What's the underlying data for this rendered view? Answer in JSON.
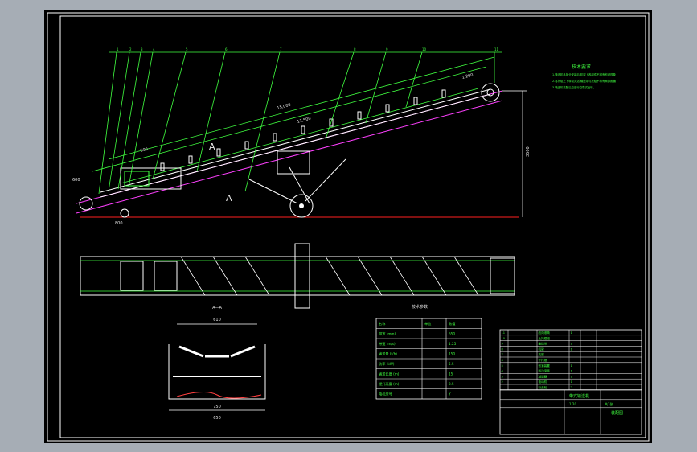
{
  "drawing": {
    "title": "",
    "section_label": "A—A",
    "view_label": "A",
    "dims": {
      "length": "15,000",
      "length_inner": "11,500",
      "height": "3500",
      "top": "1,200",
      "left_small": "600",
      "base": "800",
      "upper_left": "500",
      "sec_top": "610",
      "sec_mid": "750",
      "sec_bottom": "650"
    },
    "callouts": [
      "1",
      "2",
      "3",
      "4",
      "5",
      "6",
      "7",
      "8",
      "9",
      "10",
      "11"
    ],
    "tech_req": {
      "title": "技术要求",
      "lines": [
        "1.输送机各部分安装后,机架上各部件不得有松动现象",
        "2.各托辊上下转动灵活,输送带与托辊不得有局部跑偏",
        "3.输送机装配后应进行空载试运转。"
      ]
    },
    "spec_table": {
      "title": "技术参数",
      "header": [
        "名称",
        "单位",
        "数值"
      ],
      "rows": [
        [
          "带宽 (mm)",
          "",
          "650"
        ],
        [
          "带速 (m/s)",
          "",
          "1.25"
        ],
        [
          "输送量 (t/h)",
          "",
          "150"
        ],
        [
          "功率 (kW)",
          "",
          "5.5"
        ],
        [
          "输送长度 (m)",
          "",
          "15"
        ],
        [
          "提升高度 (m)",
          "",
          "3.5"
        ],
        [
          "电机型号",
          "",
          "Y"
        ]
      ]
    },
    "bom": {
      "rows": [
        [
          "11",
          "",
          "改向滚筒",
          "1",
          ""
        ],
        [
          "10",
          "",
          "上托辊组",
          "",
          ""
        ],
        [
          "9",
          "",
          "输送带",
          "1",
          ""
        ],
        [
          "8",
          "",
          "机架",
          "1",
          ""
        ],
        [
          "7",
          "",
          "支腿",
          "",
          ""
        ],
        [
          "6",
          "",
          "下托辊",
          "",
          ""
        ],
        [
          "5",
          "",
          "张紧装置",
          "1",
          ""
        ],
        [
          "4",
          "",
          "驱动滚筒",
          "1",
          ""
        ],
        [
          "3",
          "",
          "减速器",
          "1",
          ""
        ],
        [
          "2",
          "",
          "电动机",
          "1",
          ""
        ],
        [
          "1",
          "",
          "行走轮",
          "2",
          ""
        ]
      ],
      "title_block": {
        "name": "带式输送机",
        "scale": "1:20",
        "sheet": "共1张",
        "drawing_no": "装配图"
      }
    }
  }
}
